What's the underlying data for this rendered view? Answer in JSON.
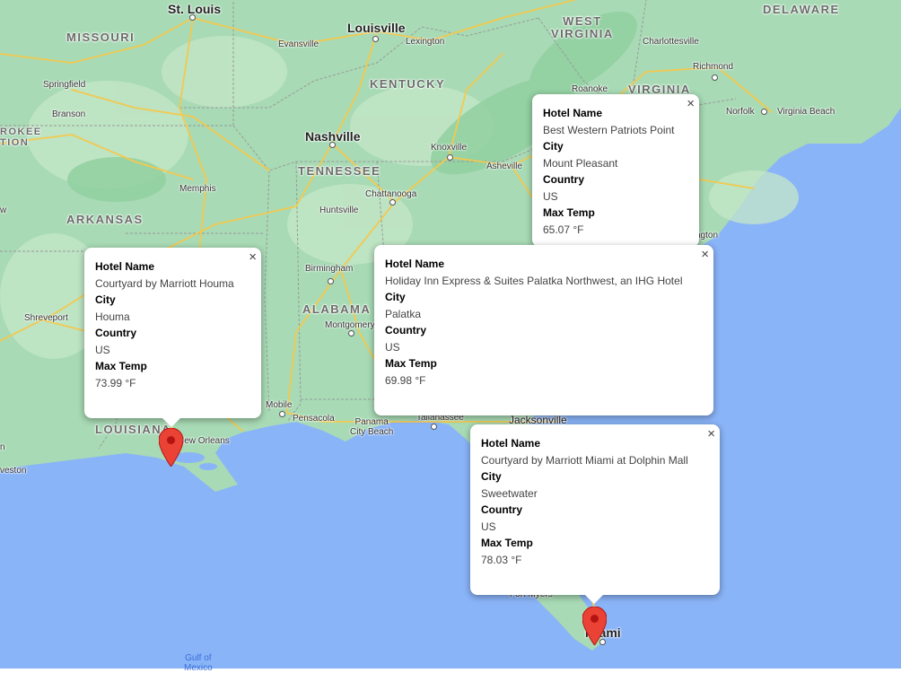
{
  "map": {
    "state_labels": [
      "MISSOURI",
      "KENTUCKY",
      "WEST\nVIRGINIA",
      "VIRGINIA",
      "DELAWARE",
      "TENNESSEE",
      "ARKANSAS",
      "ALABAMA",
      "LOUISIANA",
      "ROKEE\nTION"
    ],
    "major_cities": [
      "St. Louis",
      "Louisville",
      "Nashville",
      "Jacksonville",
      "Miami"
    ],
    "minor_cities": [
      "Evansville",
      "Lexington",
      "Charlottesville",
      "Richmond",
      "Roanoke",
      "Norfolk",
      "Virginia Beach",
      "Springfield",
      "Branson",
      "Knoxville",
      "Asheville",
      "Memphis",
      "Chattanooga",
      "Huntsville",
      "Birmingham",
      "Shreveport",
      "Montgomery",
      "Mobile",
      "Pensacola",
      "Panama City Beach",
      "Tallahassee",
      "New Orleans",
      "Fort Myers",
      "veston",
      "n",
      "w",
      "ngton"
    ],
    "water_labels": [
      "Gulf of\nMexico"
    ]
  },
  "infowindows": [
    {
      "id": "houma",
      "hotel_name_label": "Hotel Name",
      "hotel_name": "Courtyard by Marriott Houma",
      "city_label": "City",
      "city": "Houma",
      "country_label": "Country",
      "country": "US",
      "max_temp_label": "Max Temp",
      "max_temp": "73.99 °F",
      "close": "×"
    },
    {
      "id": "mountpleasant",
      "hotel_name_label": "Hotel Name",
      "hotel_name": "Best Western Patriots Point",
      "city_label": "City",
      "city": "Mount Pleasant",
      "country_label": "Country",
      "country": "US",
      "max_temp_label": "Max Temp",
      "max_temp": "65.07 °F",
      "close": "×"
    },
    {
      "id": "palatka",
      "hotel_name_label": "Hotel Name",
      "hotel_name": "Holiday Inn Express & Suites Palatka Northwest, an IHG Hotel",
      "city_label": "City",
      "city": "Palatka",
      "country_label": "Country",
      "country": "US",
      "max_temp_label": "Max Temp",
      "max_temp": "69.98 °F",
      "close": "×"
    },
    {
      "id": "sweetwater",
      "hotel_name_label": "Hotel Name",
      "hotel_name": "Courtyard by Marriott Miami at Dolphin Mall",
      "city_label": "City",
      "city": "Sweetwater",
      "country_label": "Country",
      "country": "US",
      "max_temp_label": "Max Temp",
      "max_temp": "78.03 °F",
      "close": "×"
    }
  ],
  "colors": {
    "ocean": "#8ab4f8",
    "land": "#a8dab5",
    "land_light": "#c0e6c5",
    "highway": "#f7d46b",
    "border": "#9a9a9a",
    "marker": "#ea4335",
    "marker_dark": "#b31412"
  }
}
